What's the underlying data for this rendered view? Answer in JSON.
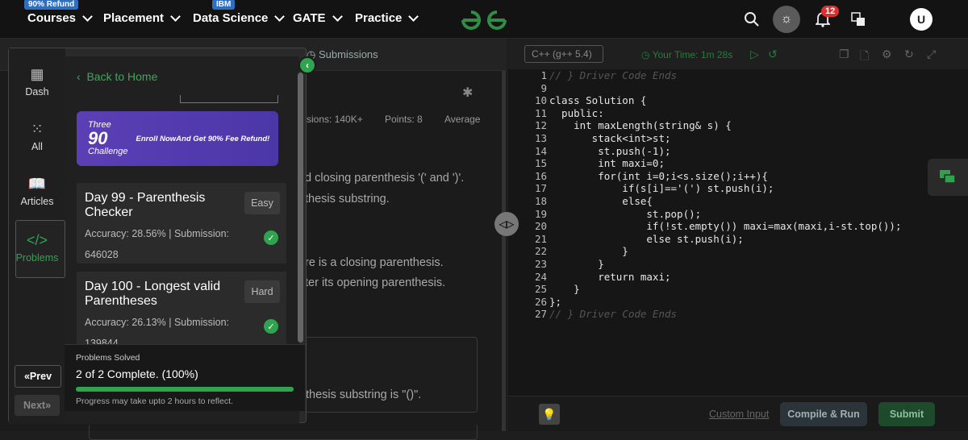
{
  "nav": {
    "items": [
      {
        "label": "Courses",
        "badge": "90% Refund"
      },
      {
        "label": "Placement",
        "badge": ""
      },
      {
        "label": "Data Science",
        "badge": "IBM"
      },
      {
        "label": "GATE",
        "badge": ""
      },
      {
        "label": "Practice",
        "badge": ""
      }
    ],
    "notification_count": "12",
    "avatar_initial": "U"
  },
  "problem": {
    "submissions_tab": "Submissions",
    "stats": {
      "submissions": "sions: 140K+",
      "points": "Points: 8",
      "average": "Average"
    },
    "desc_lines": [
      "d closing parenthesis '(' and ')'.",
      "thesis substring.",
      "re is a closing parenthesis.",
      "ter its opening parenthesis."
    ],
    "example_text": "thesis  substring  is  \"()\"."
  },
  "editor": {
    "language": "C++ (g++ 5.4)",
    "timer": "Your Time: 1m 28s",
    "line_numbers": [
      "1",
      "9",
      "10",
      "11",
      "12",
      "13",
      "14",
      "15",
      "16",
      "17",
      "18",
      "19",
      "20",
      "21",
      "22",
      "23",
      "24",
      "25",
      "26",
      "27"
    ],
    "code_lines": [
      "// } Driver Code Ends",
      "",
      "class Solution {",
      "  public:",
      "    int maxLength(string& s) {",
      "       stack<int>st;",
      "        st.push(-1);",
      "        int maxi=0;",
      "        for(int i=0;i<s.size();i++){",
      "            if(s[i]=='(') st.push(i);",
      "            else{",
      "                st.pop();",
      "                if(!st.empty()) maxi=max(maxi,i-st.top());",
      "                else st.push(i);",
      "            }",
      "        }",
      "        return maxi;",
      "    }",
      "};",
      "// } Driver Code Ends"
    ],
    "custom_input": "Custom Input",
    "compile_label": "Compile & Run",
    "submit_label": "Submit"
  },
  "side": {
    "rail": [
      {
        "label": "Dash",
        "icon": "dashboard-icon"
      },
      {
        "label": "All",
        "icon": "grid-icon"
      },
      {
        "label": "Articles",
        "icon": "book-icon"
      },
      {
        "label": "Problems",
        "icon": "code-icon"
      }
    ],
    "prev_label": "Prev",
    "next_label": "Next",
    "back_home": "Back to Home",
    "promo": {
      "logo_top": "Three",
      "logo_num": "90",
      "logo_bottom": "Challenge",
      "text": "Enroll NowAnd Get 90% Fee Refund!"
    },
    "cards": [
      {
        "title": "Day 99 - Parenthesis Checker",
        "difficulty": "Easy",
        "meta_line1": "Accuracy: 28.56% | Submission:",
        "meta_line2": "646028"
      },
      {
        "title": "Day 100 - Longest valid Parentheses",
        "difficulty": "Hard",
        "meta_line1": "Accuracy: 26.13% | Submission:",
        "meta_line2": "139844"
      }
    ],
    "progress": {
      "title": "Problems Solved",
      "count": "2 of 2 Complete. (100%)",
      "fraction": 1.0,
      "note": "Progress may take upto 2 hours to reflect."
    }
  },
  "colors": {
    "accent": "#2ea44f",
    "brand": "#2f8d46"
  }
}
